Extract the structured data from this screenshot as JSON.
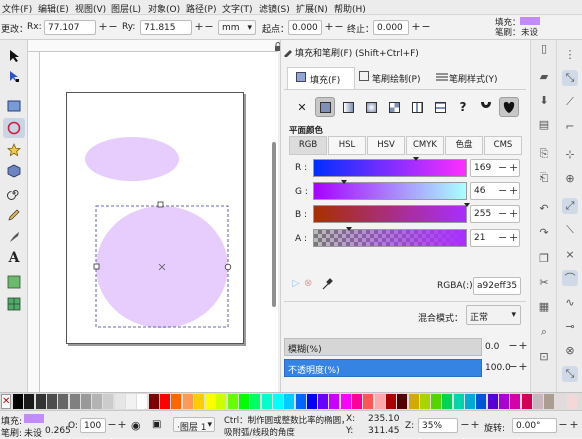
{
  "menu": [
    "文件(F)",
    "编辑(E)",
    "视图(V)",
    "图层(L)",
    "对象(O)",
    "路径(P)",
    "文字(T)",
    "滤镜(S)",
    "扩展(N)",
    "帮助(H)"
  ],
  "tool_controls": {
    "label_left": "更改：",
    "rx_label": "Rx:",
    "rx_value": "77.107",
    "ry_label": "Ry:",
    "ry_value": "71.815",
    "unit": "mm",
    "start_label": "起点：",
    "start_value": "0.000",
    "end_label": "终止：",
    "end_value": "0.000",
    "fill_label": "填充：",
    "stroke_label": "笔刷：",
    "stroke_value": "未设"
  },
  "dialog": {
    "title": "填充和笔刷(F) (Shift+Ctrl+F)",
    "tabs": [
      "填充(F)",
      "笔刷绘制(P)",
      "笔刷样式(Y)"
    ],
    "flat_color_label": "平面颜色",
    "color_modes": [
      "RGB",
      "HSL",
      "HSV",
      "CMYK",
      "色盘",
      "CMS"
    ],
    "channels": [
      {
        "label": "R :",
        "value": "169",
        "fraction": 0.663
      },
      {
        "label": "G :",
        "value": "46",
        "fraction": 0.18
      },
      {
        "label": "B :",
        "value": "255",
        "fraction": 1.0
      },
      {
        "label": "A :",
        "value": "21",
        "fraction": 0.21
      }
    ],
    "rgba_label": "RGBA(:):",
    "rgba_value": "a92eff35",
    "blend_label": "混合模式：",
    "blend_value": "正常",
    "blur_label": "模糊(%)",
    "blur_value": "0.0",
    "opacity_label": "不透明度(%)",
    "opacity_value": "100.0"
  },
  "status": {
    "fill_label": "填充:",
    "stroke_label": "笔刷:",
    "stroke_value": "未设",
    "stroke_width": "0.265",
    "o_label": "O:",
    "o_value": "100",
    "layer": "·图层 1",
    "hint_line1": "Ctrl：制作圆或整数比率的椭圆，",
    "hint_line2": "吸附弧/线段的角度",
    "x_label": "X:",
    "x_value": "235.10",
    "y_label": "Y:",
    "y_value": "311.45",
    "z_label": "Z:",
    "zoom": "35%",
    "rot_label": "旋转:",
    "rotation": "0.00°"
  },
  "colors": {
    "ellipse_fill": "#e6cdfe",
    "accent": "#a92eff",
    "opacity_bar": "#3584e4"
  },
  "palette_colors": [
    "#000000",
    "#1a1a1a",
    "#333333",
    "#4d4d4d",
    "#666666",
    "#808080",
    "#999999",
    "#b3b3b3",
    "#cccccc",
    "#e6e6e6",
    "#f2f2f2",
    "#ffffff",
    "#800000",
    "#ff0000",
    "#ff6600",
    "#ff9955",
    "#ffcc00",
    "#ffff00",
    "#ccff00",
    "#66ff00",
    "#00ff00",
    "#00ff66",
    "#00ffcc",
    "#00ffff",
    "#00ccff",
    "#0066ff",
    "#0000ff",
    "#6600ff",
    "#cc00ff",
    "#ff00ff",
    "#ff0099",
    "#ff5555",
    "#ffaaaa",
    "#aa0000",
    "#550000",
    "#d4aa00",
    "#aad400",
    "#55d400",
    "#00d455",
    "#00d4aa",
    "#00aad4",
    "#0055d4",
    "#5500d4",
    "#aa00d4",
    "#d400aa",
    "#d40055",
    "#c8b7be",
    "#ac9d93",
    "#e3dbdb",
    "#f4d7d7"
  ]
}
